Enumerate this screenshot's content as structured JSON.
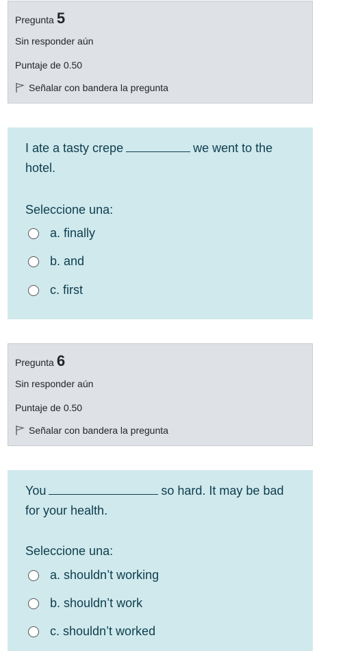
{
  "questions": [
    {
      "label": "Pregunta",
      "number": "5",
      "status": "Sin responder aún",
      "score": "Puntaje de 0.50",
      "flag_label": "Señalar con bandera la pregunta",
      "text_before": "I ate a tasty crepe",
      "text_after": "we went to the hotel.",
      "select_label": "Seleccione una:",
      "options": [
        "a. finally",
        "b. and",
        "c. first"
      ]
    },
    {
      "label": "Pregunta",
      "number": "6",
      "status": "Sin responder aún",
      "score": "Puntaje de 0.50",
      "flag_label": "Señalar con bandera la pregunta",
      "text_before": "You",
      "text_after": "so hard. It may be bad for your health.",
      "select_label": "Seleccione una:",
      "options": [
        "a. shouldn’t working",
        "b. shouldn’t work",
        "c. shouldn’t worked"
      ]
    }
  ],
  "colors": {
    "info_bg": "#dee2e6",
    "content_bg": "#d0e9ed",
    "content_text": "#0d3d4d"
  }
}
